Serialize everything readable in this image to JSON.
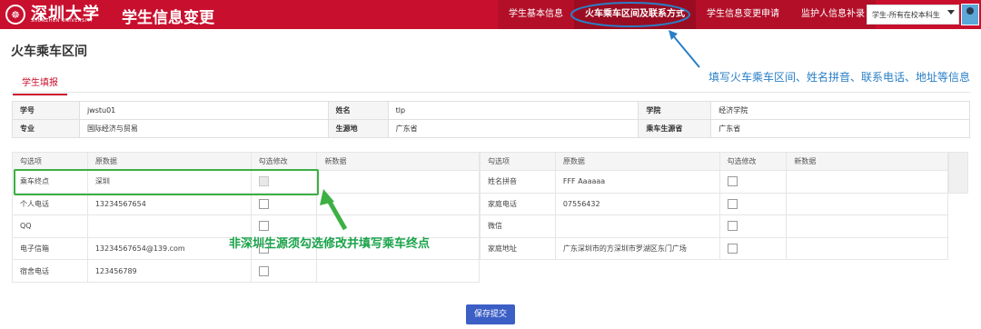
{
  "header": {
    "logo_text": "深圳大学",
    "logo_sub": "SHENZHEN UNIVERSITY",
    "app_title": "学生信息变更",
    "nav": [
      {
        "label": "学生基本信息"
      },
      {
        "label": "火车乘车区间及联系方式"
      },
      {
        "label": "学生信息变更申请"
      },
      {
        "label": "监护人信息补录"
      }
    ],
    "user_selector": "学生-所有在校本科生"
  },
  "page": {
    "title": "火车乘车区间",
    "tab": "学生填报",
    "save_button": "保存提交"
  },
  "info": {
    "rows": [
      [
        "学号",
        "jwstu01",
        "姓名",
        "tlp",
        "学院",
        "经济学院"
      ],
      [
        "专业",
        "国际经济与贸易",
        "生源地",
        "广东省",
        "乘车生源省",
        "广东省"
      ]
    ]
  },
  "left_table": {
    "headers": [
      "勾选项",
      "原数据",
      "勾选修改",
      "新数据"
    ],
    "rows": [
      {
        "item": "乘车终点",
        "value": "深圳",
        "disabled": true
      },
      {
        "item": "个人电话",
        "value": "13234567654",
        "disabled": false
      },
      {
        "item": "QQ",
        "value": "",
        "disabled": false
      },
      {
        "item": "电子信箱",
        "value": "13234567654@139.com",
        "disabled": false
      },
      {
        "item": "宿舍电话",
        "value": "123456789",
        "disabled": false
      }
    ]
  },
  "right_table": {
    "headers": [
      "勾选项",
      "原数据",
      "勾选修改",
      "新数据"
    ],
    "rows": [
      {
        "item": "姓名拼音",
        "value": "FFF Aaaaaa"
      },
      {
        "item": "家庭电话",
        "value": "07556432"
      },
      {
        "item": "微信",
        "value": ""
      },
      {
        "item": "家庭地址",
        "value": "广东深圳市的方深圳市罗湖区东门广场"
      }
    ]
  },
  "annotations": {
    "top_note": "填写火车乘车区间、姓名拼音、联系电话、地址等信息",
    "bottom_note": "非深圳生源须勾选修改并填写乘车终点"
  },
  "colors": {
    "brand_red": "#c8102e",
    "annotation_blue": "#2a7fc6",
    "annotation_green": "#1aa34a",
    "save_blue": "#3c5fc6"
  }
}
